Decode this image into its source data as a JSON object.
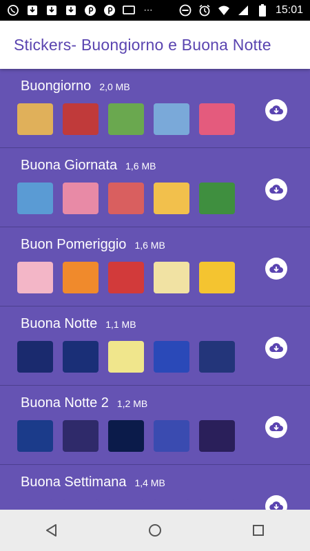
{
  "status_bar": {
    "time": "15:01",
    "left_icons": [
      "whatsapp-icon",
      "download-icon",
      "download-icon",
      "download-icon",
      "pinterest-icon",
      "pinterest-icon",
      "screen-icon"
    ],
    "overflow": "⋯",
    "right_icons": [
      "do-not-disturb-icon",
      "alarm-icon",
      "wifi-icon",
      "signal-icon",
      "battery-icon"
    ]
  },
  "app_bar": {
    "title": "Stickers- Buongiorno e Buona Notte"
  },
  "colors": {
    "background": "#6553b3",
    "title": "#5a44b0",
    "divider": "#4c3f8f"
  },
  "packs": [
    {
      "name": "Buongiorno",
      "size": "2,0 MB",
      "sticker_colors": [
        "#e0b05a",
        "#c03a3a",
        "#6aa84f",
        "#7aa9d9",
        "#e45b7d"
      ]
    },
    {
      "name": "Buona Giornata",
      "size": "1,6 MB",
      "sticker_colors": [
        "#5a9bd4",
        "#e88aa6",
        "#d95f5f",
        "#f2c04c",
        "#3f8f3f"
      ]
    },
    {
      "name": "Buon Pomeriggio",
      "size": "1,6 MB",
      "sticker_colors": [
        "#f3b6c7",
        "#f08a2c",
        "#d23a3a",
        "#f1e2a3",
        "#f4c430"
      ]
    },
    {
      "name": "Buona Notte",
      "size": "1,1 MB",
      "sticker_colors": [
        "#1a2a6e",
        "#1a2f77",
        "#f0e68c",
        "#2a49b8",
        "#23357a"
      ]
    },
    {
      "name": "Buona Notte 2",
      "size": "1,2 MB",
      "sticker_colors": [
        "#1b3b8a",
        "#2f2a6a",
        "#0b1b4a",
        "#3a4bb0",
        "#2a1f5a"
      ]
    },
    {
      "name": "Buona Settimana",
      "size": "1,4 MB",
      "sticker_colors": [
        "#6553b3",
        "#6553b3",
        "#6553b3",
        "#6553b3",
        "#6553b3"
      ]
    }
  ],
  "nav_bar": {
    "buttons": [
      "back-icon",
      "home-icon",
      "recents-icon"
    ]
  }
}
